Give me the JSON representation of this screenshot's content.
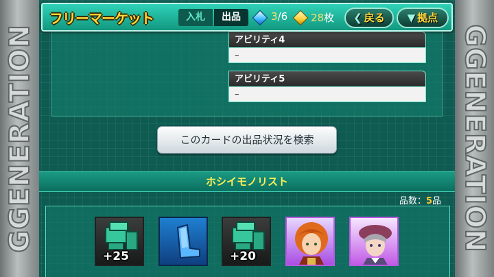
{
  "rails": {
    "text": "GGENERATION"
  },
  "header": {
    "title": "フリーマーケット",
    "tab_bid": "入札",
    "tab_sell": "出品",
    "gem_used": "3",
    "gem_sep": "/",
    "gem_total": "6",
    "tickets": "28",
    "tickets_unit": "枚",
    "back_label": "戻る",
    "base_label": "拠点"
  },
  "abilities": [
    {
      "label": "アビリティ4",
      "value": "–"
    },
    {
      "label": "アビリティ5",
      "value": "–"
    }
  ],
  "search_button": "このカードの出品状況を検索",
  "wishlist": {
    "title": "ホシイモノリスト",
    "count_label": "品数：",
    "count_value": "5",
    "count_unit": "品",
    "items": [
      {
        "kind": "part",
        "icon": "mech-part-icon",
        "badge": "+25"
      },
      {
        "kind": "skill",
        "icon": "seat-icon",
        "badge": ""
      },
      {
        "kind": "part",
        "icon": "mech-part-icon",
        "badge": "+20"
      },
      {
        "kind": "pilot",
        "icon": "pilot-portrait-icon",
        "badge": ""
      },
      {
        "kind": "pilot",
        "icon": "pilot-portrait-icon",
        "badge": ""
      }
    ]
  },
  "colors": {
    "background": "#0e5b52",
    "accent_yellow": "#ffd93a",
    "header_teal": "#2fd2b8"
  }
}
